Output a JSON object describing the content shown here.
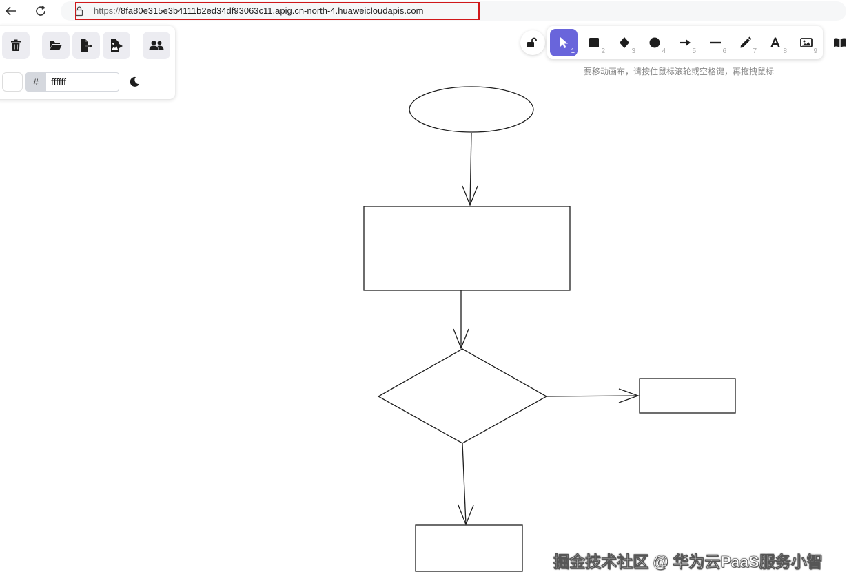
{
  "browser": {
    "url_scheme": "https://",
    "url_host": "8fa80e315e3b4111b2ed34df93063c11.apig.cn-north-4.huaweicloudapis.com",
    "back_icon": "arrow-left-icon",
    "reload_icon": "reload-icon"
  },
  "left_panel": {
    "buttons": [
      {
        "name": "clear-canvas-button",
        "icon": "trash-icon"
      },
      {
        "name": "open-button",
        "icon": "folder-open-icon"
      },
      {
        "name": "save-button",
        "icon": "file-export-icon"
      },
      {
        "name": "export-image-button",
        "icon": "image-export-icon"
      },
      {
        "name": "collaboration-button",
        "icon": "users-icon"
      }
    ],
    "background_label": "#",
    "background_value": "ffffff",
    "background_color": "#ffffff",
    "theme_icon": "moon-icon"
  },
  "toolbar": {
    "lock_icon": "unlock-icon",
    "tools": [
      {
        "name": "selection",
        "key": "1",
        "icon": "pointer-icon",
        "active": true
      },
      {
        "name": "rectangle",
        "key": "2",
        "icon": "square-icon"
      },
      {
        "name": "diamond",
        "key": "3",
        "icon": "diamond-icon"
      },
      {
        "name": "ellipse",
        "key": "4",
        "icon": "circle-icon"
      },
      {
        "name": "arrow",
        "key": "5",
        "icon": "arrow-right-icon"
      },
      {
        "name": "line",
        "key": "6",
        "icon": "line-icon"
      },
      {
        "name": "draw",
        "key": "7",
        "icon": "pencil-icon"
      },
      {
        "name": "text",
        "key": "8",
        "icon": "text-icon"
      },
      {
        "name": "image",
        "key": "9",
        "icon": "image-icon"
      }
    ],
    "library_icon": "book-open-icon",
    "accent_color": "#6965db",
    "hint": "要移动画布，请按住鼠标滚轮或空格键，再拖拽鼠标"
  },
  "canvas": {
    "shapes": [
      {
        "name": "start-ellipse",
        "type": "ellipse"
      },
      {
        "name": "process-rectangle",
        "type": "rectangle"
      },
      {
        "name": "decision-diamond",
        "type": "diamond"
      },
      {
        "name": "branch-rectangle",
        "type": "rectangle"
      },
      {
        "name": "end-rectangle",
        "type": "rectangle"
      }
    ]
  },
  "watermark": "掘金技术社区 @ 华为云PaaS服务小智"
}
